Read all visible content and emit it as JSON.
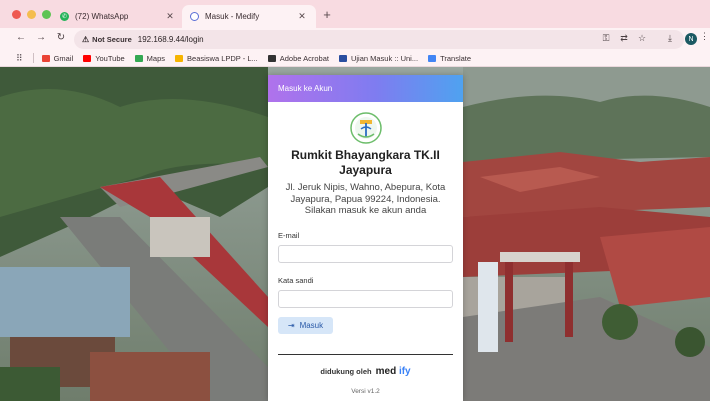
{
  "browser": {
    "tabs": [
      {
        "title": "(72) WhatsApp",
        "favicon": "whatsapp-icon"
      },
      {
        "title": "Masuk - Medify",
        "favicon": "medify-icon"
      }
    ],
    "address": {
      "security_label": "Not Secure",
      "url": "192.168.9.44/login"
    },
    "profile_initial": "N",
    "bookmarks": [
      {
        "label": "Gmail",
        "icon": "gmail-icon"
      },
      {
        "label": "YouTube",
        "icon": "youtube-icon"
      },
      {
        "label": "Maps",
        "icon": "maps-icon"
      },
      {
        "label": "Beasiswa LPDP - L...",
        "icon": "lpdp-icon"
      },
      {
        "label": "Adobe Acrobat",
        "icon": "acrobat-icon"
      },
      {
        "label": "Ujian Masuk :: Uni...",
        "icon": "ujian-icon"
      },
      {
        "label": "Translate",
        "icon": "translate-icon"
      }
    ]
  },
  "login": {
    "header": "Masuk ke Akun",
    "hospital_name": "Rumkit Bhayangkara TK.II Jayapura",
    "address": "Jl. Jeruk Nipis, Wahno, Abepura, Kota Jayapura, Papua 99224, Indonesia.",
    "subtitle": "Silakan masuk ke akun anda",
    "email_label": "E-mail",
    "email_value": "",
    "password_label": "Kata sandi",
    "password_value": "",
    "submit_label": "Masuk",
    "powered_by": "didukung oleh",
    "brand_med": "med",
    "brand_ify": "ify",
    "version": "Versi v1.2"
  },
  "colors": {
    "tab_strip": "#f8dbe1",
    "card_header_start": "#b072ec",
    "card_header_end": "#4fa2f0",
    "button_bg": "#d6e6f8",
    "brand_accent": "#3b82f6"
  }
}
